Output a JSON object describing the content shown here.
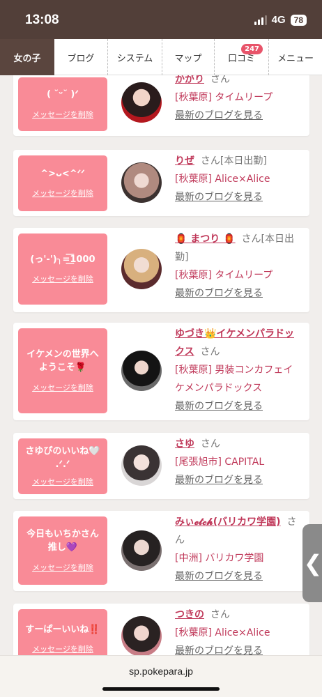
{
  "status": {
    "time": "13:08",
    "network": "4G",
    "battery": "78"
  },
  "nav": {
    "items": [
      {
        "label": "女の子"
      },
      {
        "label": "ブログ"
      },
      {
        "label": "システム"
      },
      {
        "label": "マップ"
      },
      {
        "label": "口コミ",
        "badge": "247"
      },
      {
        "label": "メニュー"
      }
    ]
  },
  "cards": [
    {
      "message": "( ˘ᵕ˘ )ᐟ",
      "delete": "メッセージを削除",
      "name": "かがり",
      "san": "さん",
      "shop": "[秋葉原] タイムリープ",
      "blog": "最新のブログを見る"
    },
    {
      "message": "^>ᴗ<^ᐟᐟ",
      "delete": "メッセージを削除",
      "name": "りぜ",
      "san": "さん[本日出勤]",
      "shop": "[秋葉原] Alice×Alice",
      "blog": "最新のブログを見る"
    },
    {
      "message": "(っ'-')╮=͟͟͞͞1000",
      "delete": "メッセージを削除",
      "name": "🏮 まつり 🏮",
      "san": "さん[本日出勤]",
      "shop": "[秋葉原] タイムリープ",
      "blog": "最新のブログを見る"
    },
    {
      "message": "イケメンの世界へようこそ🌹",
      "delete": "メッセージを削除",
      "name": "ゆづき👑イケメンパラドックス",
      "san": "さん",
      "shop": "[秋葉原] 男装コンカフェイケメンパラドックス",
      "blog": "最新のブログを見る"
    },
    {
      "message": "さゆぴのいいね🤍 .ᐟ.ᐟ",
      "delete": "メッセージを削除",
      "name": "さゆ",
      "san": "さん",
      "shop": "[尾張旭市] CAPITAL",
      "blog": "最新のブログを見る"
    },
    {
      "message": "今日もいちかさん推し💜",
      "delete": "メッセージを削除",
      "name": "みぃ𝓮𝓽𝓬𝓱(バリカワ学園)",
      "san": "さん",
      "shop": "[中洲] バリカワ学園",
      "blog": "最新のブログを見る"
    },
    {
      "message": "すーぱーいいね‼️",
      "delete": "メッセージを削除",
      "name": "つきの",
      "san": "さん",
      "shop": "[秋葉原] Alice×Alice",
      "blog": "最新のブログを見る"
    }
  ],
  "side_tab": {
    "icon": "chevron-left-icon",
    "glyph": "❮"
  },
  "url": "sp.pokepara.jp",
  "colors": {
    "status_bar": "#523f39",
    "accent_pink": "#f98b97",
    "name_color": "#c0395a",
    "badge": "#e8546a"
  }
}
